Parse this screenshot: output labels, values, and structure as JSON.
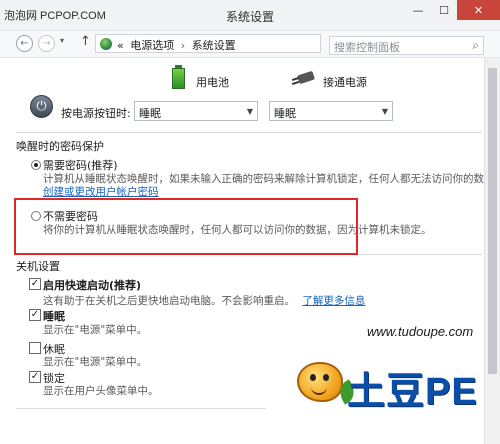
{
  "window": {
    "watermark": "泡泡网 PCPOP.COM",
    "title": "系统设置",
    "min": "—",
    "max": "☐",
    "close": "✕"
  },
  "nav": {
    "back": "←",
    "forward": "→",
    "dropdown": "▾",
    "up": "↑",
    "breadcrumb": {
      "prefix": "«",
      "items": [
        "电源选项",
        "系统设置"
      ],
      "separator": "›"
    },
    "address_dropdown": "▾",
    "refresh": "↻",
    "search_placeholder": "搜索控制面板",
    "search_icon": "⌕"
  },
  "power": {
    "battery_label": "用电池",
    "plugged_label": "接通电源",
    "button_label": "按电源按钮时:",
    "battery_value": "睡眠",
    "plugged_value": "睡眠",
    "power_glyph": "⏻"
  },
  "password": {
    "section_title": "唤醒时的密码保护",
    "require_title": "需要密码(推荐)",
    "require_desc": "计算机从睡眠状态唤醒时，如果未输入正确的密码来解除计算机锁定，任何人都无法访问你的数据。",
    "require_link": "创建或更改用户帐户密码",
    "norequire_title": "不需要密码",
    "norequire_desc": "将你的计算机从睡眠状态唤醒时，任何人都可以访问你的数据，因为计算机未锁定。"
  },
  "shutdown": {
    "section_title": "关机设置",
    "items": [
      {
        "title": "启用快速启动(推荐)",
        "desc": "这有助于在关机之后更快地启动电脑。不会影响重启。",
        "link": "了解更多信息",
        "checked": true
      },
      {
        "title": "睡眠",
        "desc": "显示在\"电源\"菜单中。",
        "checked": true
      },
      {
        "title": "休眠",
        "desc": "显示在\"电源\"菜单中。",
        "checked": false
      },
      {
        "title": "锁定",
        "desc": "显示在用户头像菜单中。",
        "checked": true
      }
    ],
    "check_glyph": "✓"
  },
  "logo": {
    "url": "www.tudoupe.com",
    "brand": "土豆PE"
  },
  "colors": {
    "highlight": "#e3262a",
    "link": "#1565c0",
    "brand": "#0a4ea8"
  }
}
